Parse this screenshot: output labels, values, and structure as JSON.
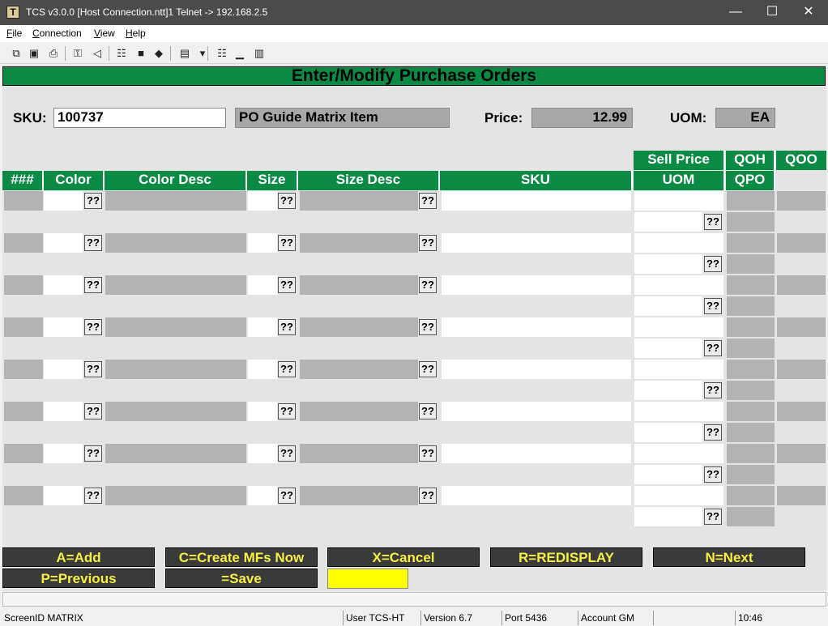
{
  "window": {
    "app_icon": "T",
    "title": "TCS v3.0.0 [Host Connection.ntt]1 Telnet -> 192.168.2.5",
    "minimize_glyph": "—",
    "maximize_glyph": "☐",
    "close_glyph": "✕"
  },
  "menu": {
    "file_key": "F",
    "file_rest": "ile",
    "connection_key": "C",
    "connection_rest": "onnection",
    "view_key": "V",
    "view_rest": "iew",
    "help_key": "H",
    "help_rest": "elp"
  },
  "toolbar": {
    "icons": [
      "copy-icon",
      "save-icon",
      "print-icon",
      "lock-icon",
      "sound-icon",
      "properties-icon",
      "monitor-icon",
      "book-icon",
      "paste-icon",
      "dropdown-arrow-icon",
      "network-icon",
      "chart-icon",
      "calculator-icon"
    ],
    "glyphs": [
      "⧉",
      "▣",
      "⎙",
      "⚿",
      "◁",
      "☷",
      "■",
      "◆",
      "▤",
      "▾",
      "☷",
      "▁",
      "▥"
    ]
  },
  "screen": {
    "title": "Enter/Modify Purchase Orders",
    "sku_label": "SKU:",
    "sku_value": "100737",
    "description": "PO Guide Matrix Item",
    "price_label": "Price:",
    "price_value": "12.99",
    "uom_label": "UOM:",
    "uom_value": "EA"
  },
  "grid": {
    "headers_top": {
      "sell_price": "Sell Price",
      "qoh": "QOH",
      "qoo": "QOO"
    },
    "headers": {
      "num": "###",
      "color": "Color",
      "color_desc": "Color Desc",
      "size": "Size",
      "size_desc": "Size Desc",
      "sku": "SKU",
      "uom": "UOM",
      "qpo": "QPO"
    },
    "lookup_label": "??",
    "row_count": 8
  },
  "fkeys": {
    "add": "A=Add",
    "create": "C=Create MFs Now",
    "cancel": "X=Cancel",
    "redisplay": "R=REDISPLAY",
    "next": "N=Next",
    "previous": "P=Previous",
    "save": "=Save",
    "highlight_color": "#ffff00",
    "key_text_color": "#f7ef44"
  },
  "status": {
    "screen_id": "ScreenID MATRIX",
    "user": "User TCS-HT",
    "version": "Version 6.7",
    "port": "Port 5436",
    "account": "Account GM",
    "time": "10:46"
  },
  "colors": {
    "accent": "#0b8a45",
    "titlebar": "#4b4b4b",
    "field_gray": "#a8a8a8"
  }
}
